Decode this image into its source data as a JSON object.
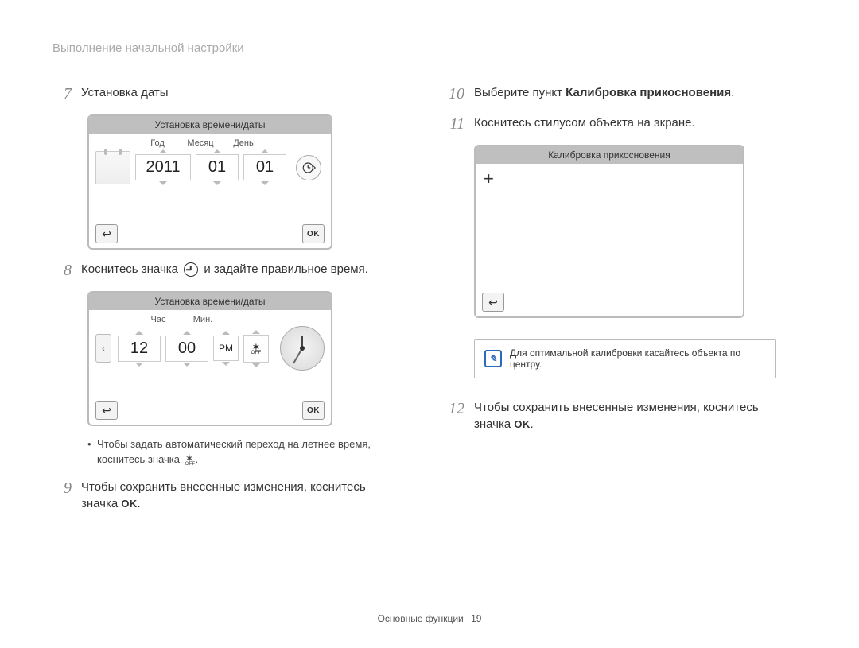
{
  "header": {
    "title": "Выполнение начальной настройки"
  },
  "footer": {
    "section": "Основные функции",
    "page": "19"
  },
  "left": {
    "step7": {
      "num": "7",
      "text": "Установка даты"
    },
    "datePanel": {
      "title": "Установка времени/даты",
      "labels": {
        "year": "Год",
        "month": "Месяц",
        "day": "День"
      },
      "values": {
        "year": "2011",
        "month": "01",
        "day": "01"
      },
      "ok": "OK"
    },
    "step8": {
      "num": "8",
      "before": "Коснитесь значка",
      "after": "и задайте правильное время."
    },
    "timePanel": {
      "title": "Установка времени/даты",
      "labels": {
        "hour": "Час",
        "min": "Мин."
      },
      "values": {
        "hour": "12",
        "min": "00",
        "ampm": "PM"
      },
      "ok": "OK"
    },
    "bullet": {
      "line1": "Чтобы задать автоматический переход на летнее время,",
      "line2_before": "коснитесь значка",
      "line2_after": "."
    },
    "step9": {
      "num": "9",
      "before": "Чтобы сохранить внесенные изменения, коснитесь",
      "after_label": "значка",
      "ok": "OK",
      "period": "."
    }
  },
  "right": {
    "step10": {
      "num": "10",
      "before": "Выберите пункт",
      "bold": "Калибровка прикосновения",
      "period": "."
    },
    "step11": {
      "num": "11",
      "text": "Коснитесь стилусом объекта на экране."
    },
    "calibPanel": {
      "title": "Калибровка прикосновения"
    },
    "note": {
      "text": "Для оптимальной калибровки касайтесь объекта по центру."
    },
    "step12": {
      "num": "12",
      "before": "Чтобы сохранить внесенные изменения, коснитесь",
      "after_label": "значка",
      "ok": "OK",
      "period": "."
    }
  }
}
